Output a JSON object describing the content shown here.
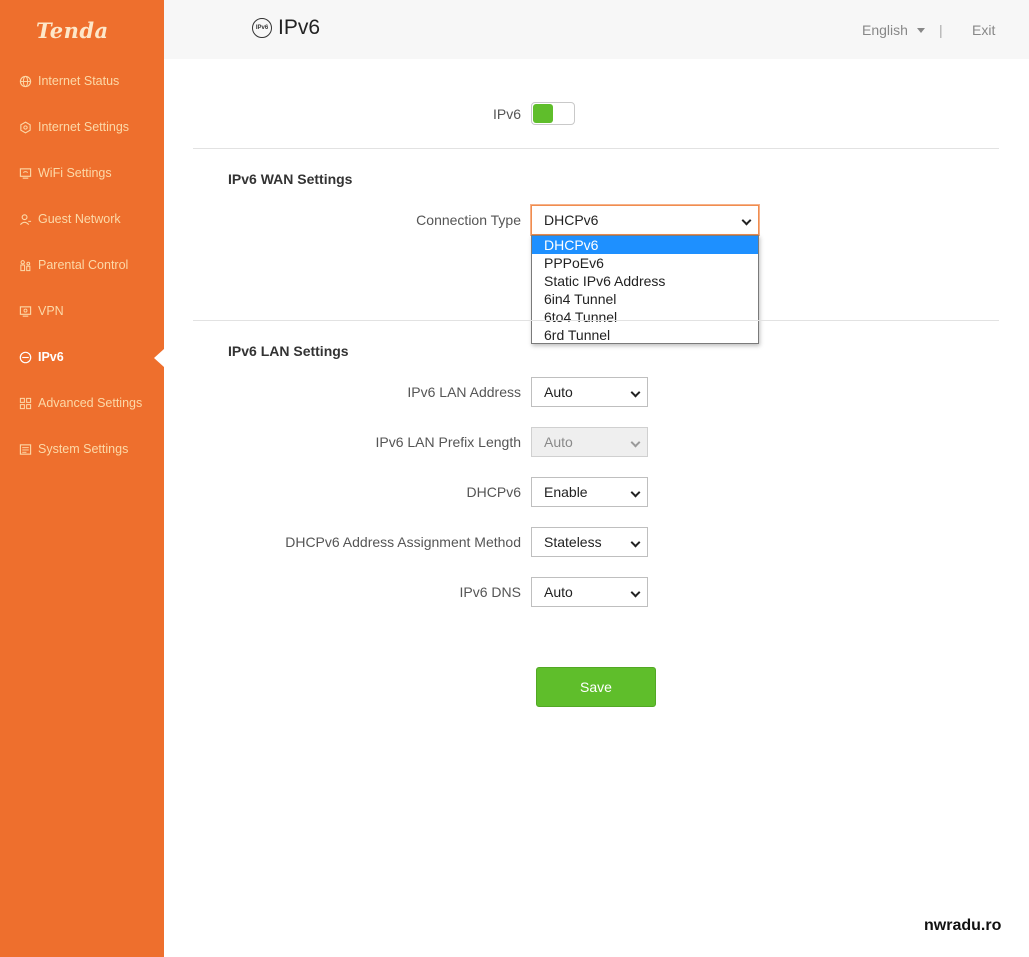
{
  "brand": {
    "logo_text": "Tenda",
    "accent": "#ee6f2d",
    "green": "#5fbe2b",
    "highlight": "#1e90ff"
  },
  "sidebar": {
    "items": [
      {
        "label": "Internet Status",
        "icon": "globe-icon",
        "active": false
      },
      {
        "label": "Internet Settings",
        "icon": "gear-icon",
        "active": false
      },
      {
        "label": "WiFi Settings",
        "icon": "wifi-icon",
        "active": false
      },
      {
        "label": "Guest Network",
        "icon": "user-icon",
        "active": false
      },
      {
        "label": "Parental Control",
        "icon": "family-icon",
        "active": false
      },
      {
        "label": "VPN",
        "icon": "vpn-icon",
        "active": false
      },
      {
        "label": "IPv6",
        "icon": "ipv6-icon",
        "active": true
      },
      {
        "label": "Advanced Settings",
        "icon": "grid-icon",
        "active": false
      },
      {
        "label": "System Settings",
        "icon": "system-icon",
        "active": false
      }
    ]
  },
  "header": {
    "title": "IPv6",
    "title_icon_text": "IPv6",
    "language": "English",
    "separator": "|",
    "exit": "Exit"
  },
  "ipv6_toggle": {
    "label": "IPv6",
    "enabled": true
  },
  "wan": {
    "section_title": "IPv6 WAN Settings",
    "connection_type_label": "Connection Type",
    "connection_type_value": "DHCPv6",
    "options": [
      "DHCPv6",
      "PPPoEv6",
      "Static IPv6 Address",
      "6in4 Tunnel",
      "6to4 Tunnel",
      "6rd Tunnel"
    ],
    "selected_index": 0
  },
  "lan": {
    "section_title": "IPv6 LAN Settings",
    "address_label": "IPv6 LAN Address",
    "address_value": "Auto",
    "prefix_label": "IPv6 LAN Prefix Length",
    "prefix_value": "Auto",
    "dhcpv6_label": "DHCPv6",
    "dhcpv6_value": "Enable",
    "assign_label": "DHCPv6 Address Assignment Method",
    "assign_value": "Stateless",
    "dns_label": "IPv6 DNS",
    "dns_value": "Auto"
  },
  "actions": {
    "save_label": "Save"
  },
  "watermark": "nwradu.ro"
}
